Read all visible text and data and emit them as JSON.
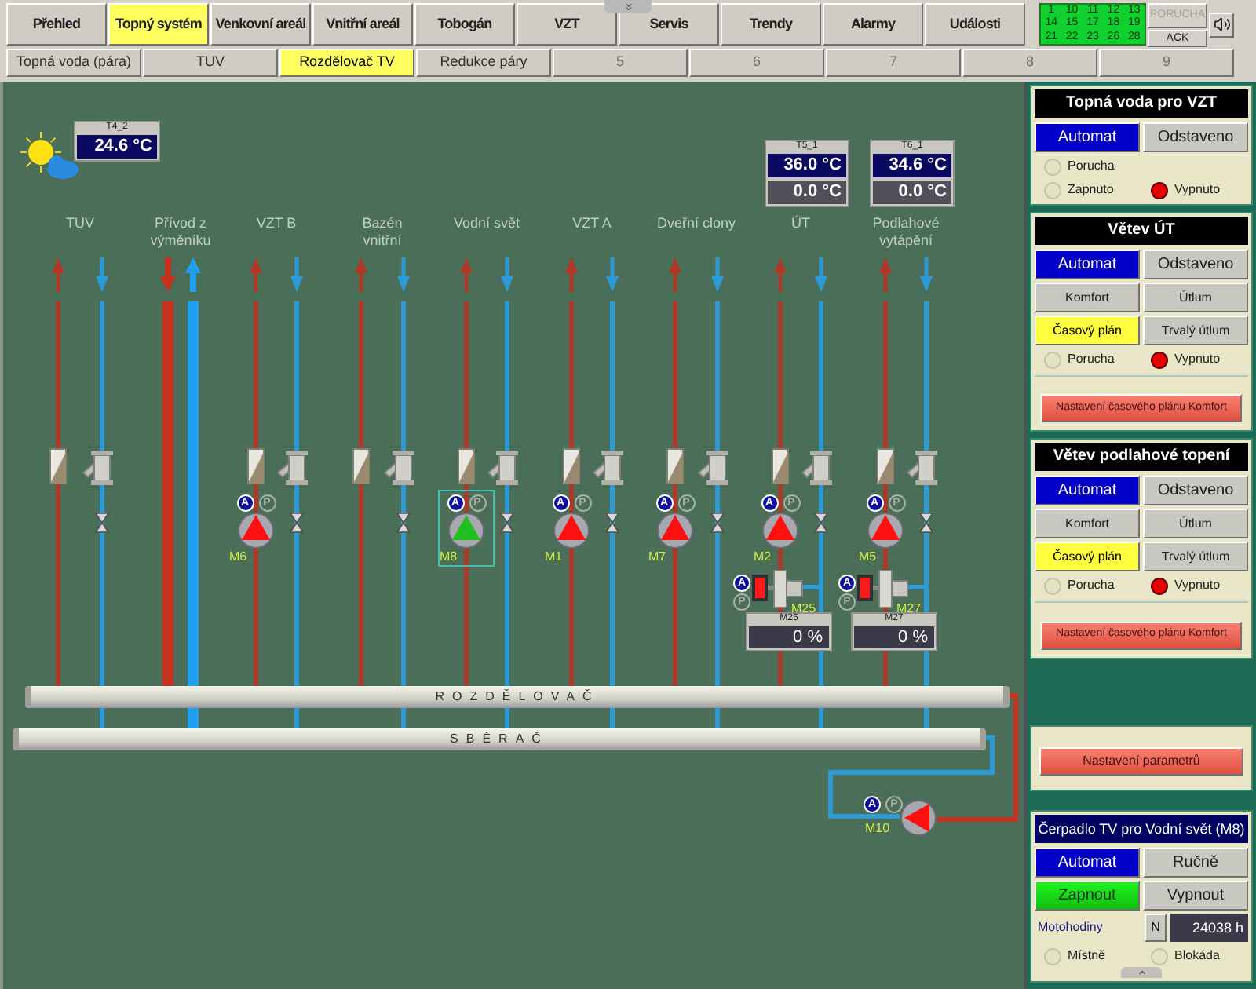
{
  "nav": [
    {
      "label": "Přehled",
      "selected": false
    },
    {
      "label": "Topný systém",
      "selected": true
    },
    {
      "label": "Venkovní areál",
      "selected": false
    },
    {
      "label": "Vnitřní areál",
      "selected": false
    },
    {
      "label": "Tobogán",
      "selected": false
    },
    {
      "label": "VZT",
      "selected": false
    },
    {
      "label": "Servis",
      "selected": false
    },
    {
      "label": "Trendy",
      "selected": false
    },
    {
      "label": "Alarmy",
      "selected": false
    },
    {
      "label": "Události",
      "selected": false
    }
  ],
  "alarm_panel": {
    "cells": [
      "1",
      "10",
      "11",
      "12",
      "13",
      "14",
      "15",
      "17",
      "18",
      "19",
      "21",
      "22",
      "23",
      "26",
      "28"
    ],
    "fault": "PORUCHA",
    "fault_active": false,
    "ack": "ACK"
  },
  "sub_tabs": [
    {
      "label": "Topná voda (pára)",
      "selected": false,
      "disabled": false
    },
    {
      "label": "TUV",
      "selected": false,
      "disabled": false
    },
    {
      "label": "Rozdělovač TV",
      "selected": true,
      "disabled": false
    },
    {
      "label": "Redukce páry",
      "selected": false,
      "disabled": false
    },
    {
      "label": "5",
      "selected": false,
      "disabled": true
    },
    {
      "label": "6",
      "selected": false,
      "disabled": true
    },
    {
      "label": "7",
      "selected": false,
      "disabled": true
    },
    {
      "label": "8",
      "selected": false,
      "disabled": true
    },
    {
      "label": "9",
      "selected": false,
      "disabled": true
    }
  ],
  "outdoor": {
    "tag": "T4_2",
    "value": "24.6 °C"
  },
  "sensors": [
    {
      "tag": "T5_1",
      "value": "36.0 °C",
      "setpoint": "0.0 °C"
    },
    {
      "tag": "T6_1",
      "value": "34.6 °C",
      "setpoint": "0.0 °C"
    }
  ],
  "branches": [
    {
      "label": [
        "TUV"
      ],
      "kind": "branch"
    },
    {
      "label": [
        "Přívod z",
        "výměníku"
      ],
      "kind": "feed"
    },
    {
      "label": [
        "VZT B"
      ],
      "kind": "branch",
      "pump": {
        "name": "M6",
        "running": false,
        "selected": false,
        "badges": [
          {
            "label": "A",
            "on": true
          },
          {
            "label": "P",
            "on": false
          }
        ]
      }
    },
    {
      "label": [
        "Bazén",
        "vnitřní"
      ],
      "kind": "branch"
    },
    {
      "label": [
        "Vodní svět"
      ],
      "kind": "branch",
      "pump": {
        "name": "M8",
        "running": true,
        "selected": true,
        "badges": [
          {
            "label": "A",
            "on": true
          },
          {
            "label": "P",
            "on": false
          }
        ]
      }
    },
    {
      "label": [
        "VZT A"
      ],
      "kind": "branch",
      "pump": {
        "name": "M1",
        "running": false,
        "selected": false,
        "badges": [
          {
            "label": "A",
            "on": true
          },
          {
            "label": "P",
            "on": false
          }
        ]
      }
    },
    {
      "label": [
        "Dveřní clony"
      ],
      "kind": "branch",
      "pump": {
        "name": "M7",
        "running": false,
        "selected": false,
        "badges": [
          {
            "label": "A",
            "on": true
          },
          {
            "label": "P",
            "on": false
          }
        ]
      }
    },
    {
      "label": [
        "ÚT"
      ],
      "kind": "branch",
      "pump": {
        "name": "M2",
        "running": false,
        "selected": false,
        "badges": [
          {
            "label": "A",
            "on": true
          },
          {
            "label": "P",
            "on": false
          }
        ]
      },
      "mixer": {
        "name": "M25",
        "tag": "M25",
        "value": "0 %",
        "badges": [
          {
            "label": "A",
            "on": true
          },
          {
            "label": "P",
            "on": false
          }
        ]
      }
    },
    {
      "label": [
        "Podlahové",
        "vytápění"
      ],
      "kind": "branch",
      "pump": {
        "name": "M5",
        "running": false,
        "selected": false,
        "badges": [
          {
            "label": "A",
            "on": true
          },
          {
            "label": "P",
            "on": false
          }
        ]
      },
      "mixer": {
        "name": "M27",
        "tag": "M27",
        "value": "0 %",
        "badges": [
          {
            "label": "A",
            "on": true
          },
          {
            "label": "P",
            "on": false
          }
        ]
      }
    }
  ],
  "distributor": "ROZDĚLOVAČ",
  "collector": "SBĚRAČ",
  "circulation_pump": {
    "name": "M10",
    "running": false,
    "badges": [
      {
        "label": "A",
        "on": true
      },
      {
        "label": "P",
        "on": false
      }
    ]
  },
  "panels": [
    {
      "title": "Topná voda pro VZT",
      "buttons": [
        {
          "label": "Automat",
          "kind": "mode",
          "selected": true
        },
        {
          "label": "Odstaveno",
          "kind": "mode",
          "selected": false
        }
      ],
      "lamp_rows": [
        [
          {
            "label": "Porucha",
            "on": false
          }
        ],
        [
          {
            "label": "Zapnuto",
            "on": false
          },
          {
            "label": "Vypnuto",
            "on": true
          }
        ]
      ]
    },
    {
      "title": "Větev ÚT",
      "buttons": [
        {
          "label": "Automat",
          "kind": "mode",
          "selected": true
        },
        {
          "label": "Odstaveno",
          "kind": "mode",
          "selected": false
        },
        {
          "label": "Komfort",
          "kind": "plan",
          "selected": false
        },
        {
          "label": "Útlum",
          "kind": "plan",
          "selected": false
        },
        {
          "label": "Časový plán",
          "kind": "plan",
          "selected": true
        },
        {
          "label": "Trvalý útlum",
          "kind": "plan",
          "selected": false
        }
      ],
      "lamp_rows": [
        [
          {
            "label": "Porucha",
            "on": false
          },
          {
            "label": "Vypnuto",
            "on": true
          }
        ]
      ],
      "action": "Nastavení časového plánu Komfort"
    },
    {
      "title": "Větev podlahové topení",
      "buttons": [
        {
          "label": "Automat",
          "kind": "mode",
          "selected": true
        },
        {
          "label": "Odstaveno",
          "kind": "mode",
          "selected": false
        },
        {
          "label": "Komfort",
          "kind": "plan",
          "selected": false
        },
        {
          "label": "Útlum",
          "kind": "plan",
          "selected": false
        },
        {
          "label": "Časový plán",
          "kind": "plan",
          "selected": true
        },
        {
          "label": "Trvalý útlum",
          "kind": "plan",
          "selected": false
        }
      ],
      "lamp_rows": [
        [
          {
            "label": "Porucha",
            "on": false
          },
          {
            "label": "Vypnuto",
            "on": true
          }
        ]
      ],
      "action": "Nastavení časového plánu Komfort"
    }
  ],
  "settings_button": "Nastavení parametrů",
  "pump_panel": {
    "title": "Čerpadlo TV pro Vodní svět (M8)",
    "buttons": [
      {
        "label": "Automat",
        "kind": "mode",
        "selected": true
      },
      {
        "label": "Ručně",
        "kind": "mode",
        "selected": false
      },
      {
        "label": "Zapnout",
        "kind": "switch",
        "selected": true
      },
      {
        "label": "Vypnout",
        "kind": "switch",
        "selected": false
      }
    ],
    "hours_label": "Motohodiny",
    "hours_button": "N",
    "hours": "24038 h",
    "lamp_rows": [
      [
        {
          "label": "Místně",
          "on": false
        },
        {
          "label": "Blokáda",
          "on": false
        }
      ]
    ]
  }
}
